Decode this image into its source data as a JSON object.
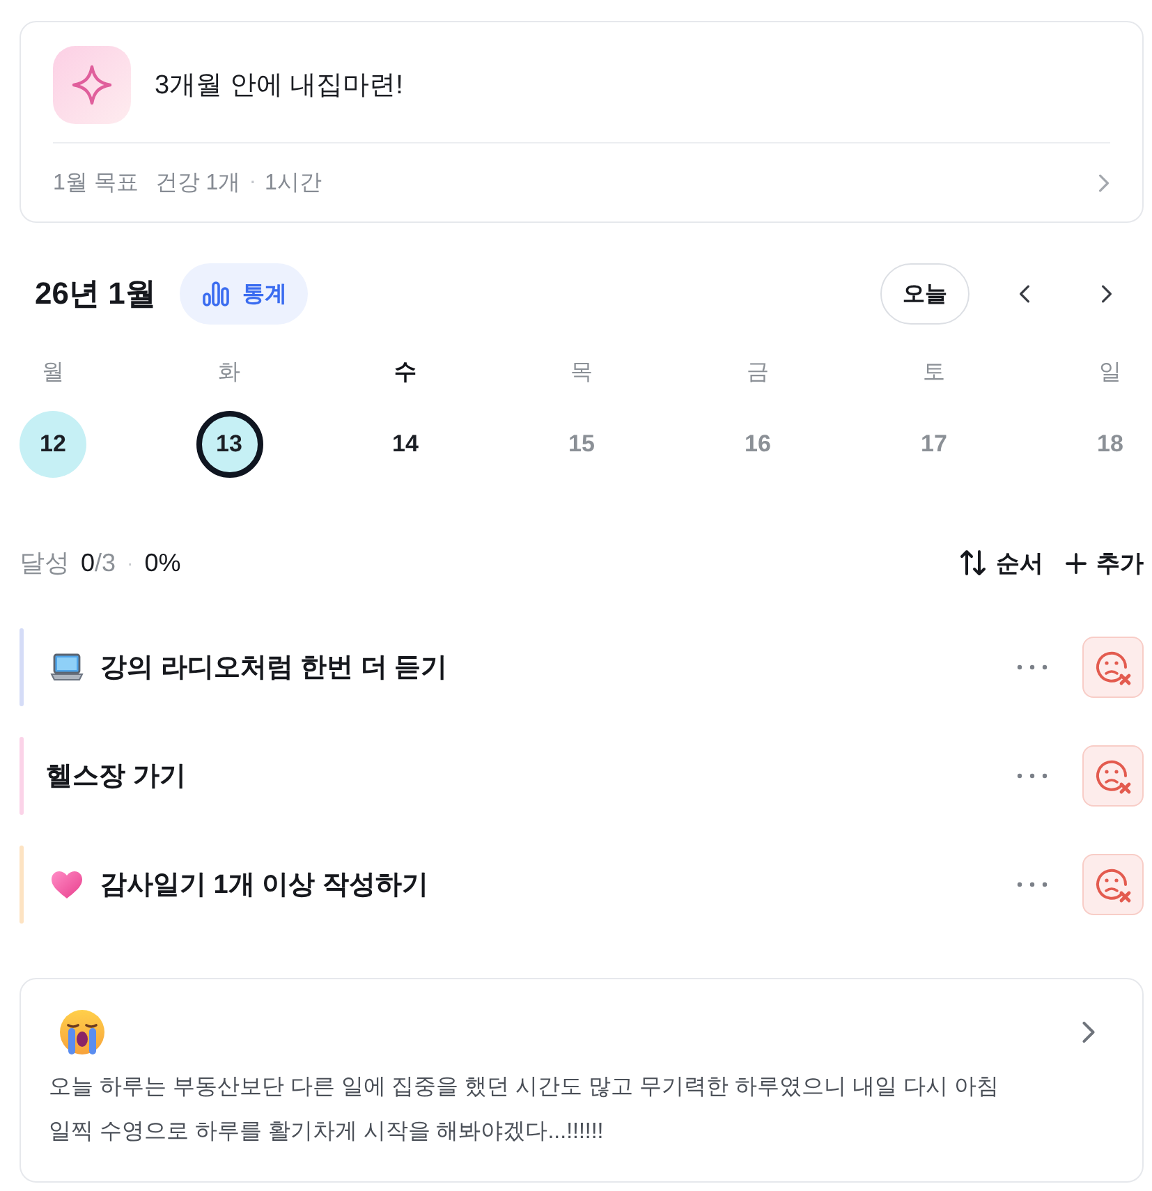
{
  "goal": {
    "title": "3개월 안에 내집마련!",
    "period": "1월 목표",
    "meta": [
      "건강 1개",
      "1시간"
    ],
    "separator": "·"
  },
  "calendar": {
    "title": "26년 1월",
    "stats_button": "통계",
    "today_button": "오늘",
    "days": [
      {
        "weekday": "월",
        "date": "12",
        "recorded": true,
        "selected": false,
        "today": false,
        "future": false
      },
      {
        "weekday": "화",
        "date": "13",
        "recorded": true,
        "selected": true,
        "today": false,
        "future": false
      },
      {
        "weekday": "수",
        "date": "14",
        "recorded": false,
        "selected": false,
        "today": true,
        "future": false
      },
      {
        "weekday": "목",
        "date": "15",
        "recorded": false,
        "selected": false,
        "today": false,
        "future": true
      },
      {
        "weekday": "금",
        "date": "16",
        "recorded": false,
        "selected": false,
        "today": false,
        "future": true
      },
      {
        "weekday": "토",
        "date": "17",
        "recorded": false,
        "selected": false,
        "today": false,
        "future": true
      },
      {
        "weekday": "일",
        "date": "18",
        "recorded": false,
        "selected": false,
        "today": false,
        "future": true
      }
    ]
  },
  "summary": {
    "label": "달성",
    "done": "0",
    "total": "/3",
    "separator": "·",
    "percent": "0%"
  },
  "actions": [
    {
      "kind": "sort",
      "label": "순서"
    },
    {
      "kind": "add",
      "label": "추가"
    }
  ],
  "tasks": [
    {
      "kind": "laptop",
      "title": "강의 라디오처럼 한번 더 듣기",
      "color": "#d5dcf7"
    },
    {
      "kind": "plain",
      "title": "헬스장 가기",
      "color": "#fbd3e8"
    },
    {
      "kind": "heart",
      "title": "감사일기 1개 이상 작성하기",
      "color": "#fde3c2"
    }
  ],
  "diary": {
    "text": "오늘 하루는 부동산보단 다른 일에 집중을 했던 시간도 많고 무기력한 하루였으니 내일 다시 아침 일찍 수영으로 하루를 활기차게 시작을 해봐야겠다...!!!!!!"
  }
}
